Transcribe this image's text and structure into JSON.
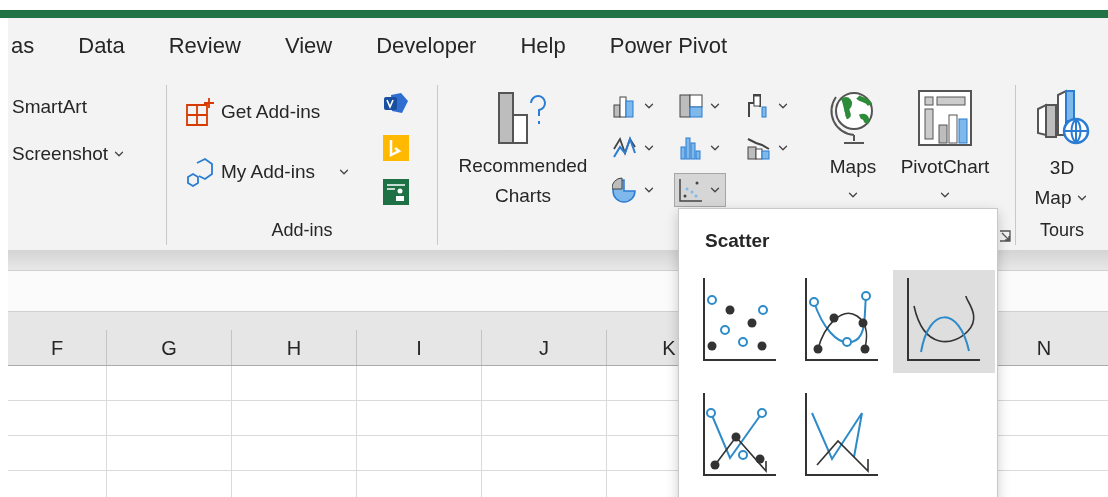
{
  "tabs": [
    {
      "label": "as"
    },
    {
      "label": "Data"
    },
    {
      "label": "Review"
    },
    {
      "label": "View"
    },
    {
      "label": "Developer"
    },
    {
      "label": "Help"
    },
    {
      "label": "Power Pivot"
    }
  ],
  "illustrations": {
    "items": [
      {
        "label": "SmartArt",
        "dropdown": false
      },
      {
        "label": "Screenshot",
        "dropdown": true
      }
    ]
  },
  "addins": {
    "get_addins": "Get Add-ins",
    "my_addins": "My Add-ins",
    "label": "Add-ins"
  },
  "charts": {
    "recommended": [
      "Recommended",
      "Charts"
    ],
    "buttons": [
      {
        "kind": "column",
        "selected": false
      },
      {
        "kind": "hierarchy",
        "selected": false
      },
      {
        "kind": "waterfall",
        "selected": false
      },
      {
        "kind": "line",
        "selected": false
      },
      {
        "kind": "statistic",
        "selected": false
      },
      {
        "kind": "combo",
        "selected": false
      },
      {
        "kind": "pie",
        "selected": false
      },
      {
        "kind": "scatter",
        "selected": true
      }
    ],
    "maps": "Maps",
    "pivotchart": "PivotChart"
  },
  "tours": {
    "map": [
      "3D",
      "Map"
    ],
    "label": "Tours"
  },
  "columns": {
    "left": [
      "F",
      "G",
      "H",
      "I",
      "J",
      "K"
    ],
    "right": [
      "N"
    ]
  },
  "scatter_menu": {
    "title": "Scatter",
    "options": [
      {
        "kind": "markers",
        "selected": false
      },
      {
        "kind": "smooth-markers",
        "selected": false
      },
      {
        "kind": "smooth",
        "selected": true
      },
      {
        "kind": "straight-markers",
        "selected": false
      },
      {
        "kind": "straight",
        "selected": false
      }
    ]
  }
}
